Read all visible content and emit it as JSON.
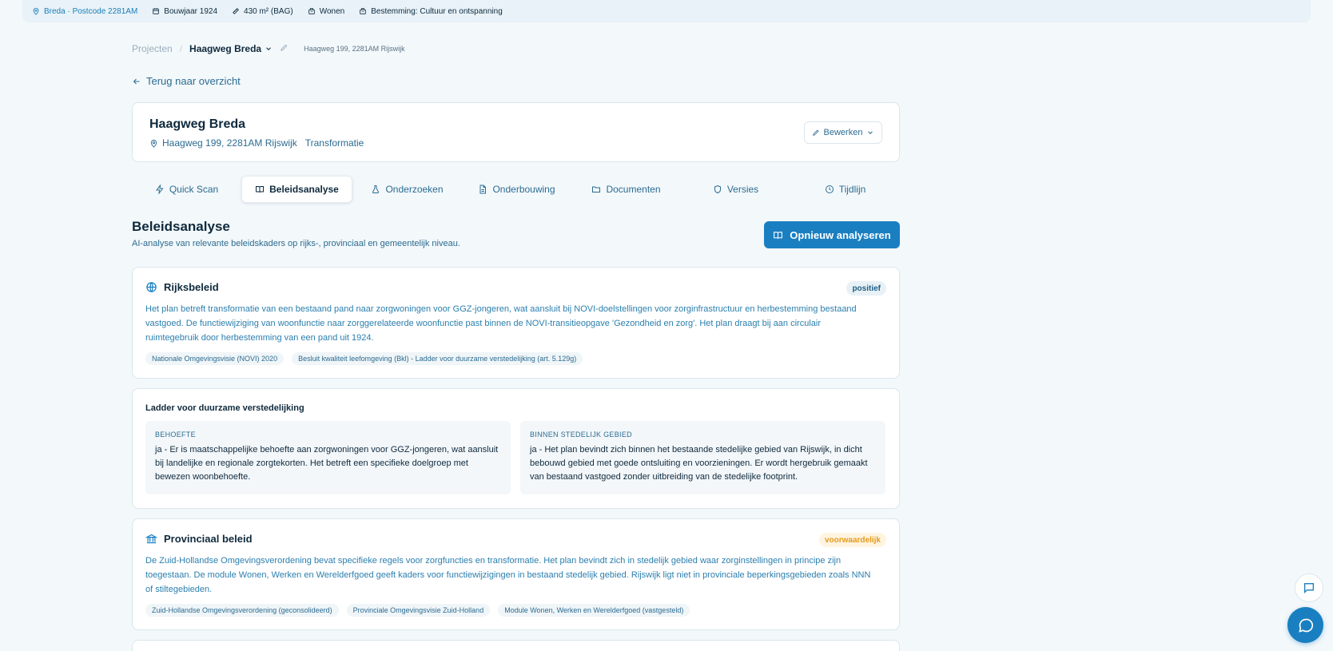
{
  "topbar": {
    "location": "Breda · Postcode 2281AM",
    "year": "Bouwjaar 1924",
    "area": "430 m² (BAG)",
    "function": "Wonen",
    "destination": "Bestemming: Cultuur en ontspanning"
  },
  "breadcrumb": {
    "root": "Projecten",
    "separator": "/",
    "project": "Haagweg Breda",
    "address": "Haagweg 199, 2281AM Rijswijk"
  },
  "back_link": "Terug naar overzicht",
  "header": {
    "title": "Haagweg Breda",
    "address": "Haagweg 199, 2281AM Rijswijk",
    "type": "Transformatie",
    "edit_label": "Bewerken"
  },
  "tabs": [
    {
      "label": "Quick Scan",
      "icon": "lightning-icon"
    },
    {
      "label": "Beleidsanalyse",
      "icon": "book-icon",
      "active": true
    },
    {
      "label": "Onderzoeken",
      "icon": "flask-icon"
    },
    {
      "label": "Onderbouwing",
      "icon": "document-icon"
    },
    {
      "label": "Documenten",
      "icon": "folder-icon"
    },
    {
      "label": "Versies",
      "icon": "shield-icon"
    },
    {
      "label": "Tijdlijn",
      "icon": "clock-icon"
    }
  ],
  "section": {
    "title": "Beleidsanalyse",
    "subtitle": "AI-analyse van relevante beleidskaders op rijks-, provinciaal en gemeentelijk niveau.",
    "reanalyze_label": "Opnieuw analyseren"
  },
  "rijksbeleid": {
    "title": "Rijksbeleid",
    "badge": "positief",
    "text": "Het plan betreft transformatie van een bestaand pand naar zorgwoningen voor GGZ-jongeren, wat aansluit bij NOVI-doelstellingen voor zorginfrastructuur en herbestemming bestaand vastgoed. De functiewijziging van woonfunctie naar zorggerelateerde woonfunctie past binnen de NOVI-transitieopgave 'Gezondheid en zorg'. Het plan draagt bij aan circulair ruimtegebruik door herbestemming van een pand uit 1924.",
    "tags": [
      "Nationale Omgevingsvisie (NOVI) 2020",
      "Besluit kwaliteit leefomgeving (Bkl) - Ladder voor duurzame verstedelijking (art. 5.129g)"
    ]
  },
  "ladder": {
    "title": "Ladder voor duurzame verstedelijking",
    "need_label": "BEHOEFTE",
    "need_text": "ja - Er is maatschappelijke behoefte aan zorgwoningen voor GGZ-jongeren, wat aansluit bij landelijke en regionale zorgtekorten. Het betreft een specifieke doelgroep met bewezen woonbehoefte.",
    "urban_label": "BINNEN STEDELIJK GEBIED",
    "urban_text": "ja - Het plan bevindt zich binnen het bestaande stedelijke gebied van Rijswijk, in dicht bebouwd gebied met goede ontsluiting en voorzieningen. Er wordt hergebruik gemaakt van bestaand vastgoed zonder uitbreiding van de stedelijke footprint."
  },
  "provinciaal": {
    "title": "Provinciaal beleid",
    "badge": "voorwaardelijk",
    "text": "De Zuid-Hollandse Omgevingsverordening bevat specifieke regels voor zorgfuncties en transformatie. Het plan bevindt zich in stedelijk gebied waar zorginstellingen in principe zijn toegestaan. De module Wonen, Werken en Werelderfgoed geeft kaders voor functiewijzigingen in bestaand stedelijk gebied. Rijswijk ligt niet in provinciale beperkingsgebieden zoals NNN of stiltegebieden.",
    "tags": [
      "Zuid-Hollandse Omgevingsverordening (geconsolideerd)",
      "Provinciale Omgevingsvisie Zuid-Holland",
      "Module Wonen, Werken en Werelderfgoed (vastgesteld)"
    ]
  },
  "colors": {
    "accent": "#1a7fc1",
    "positive_badge_bg": "#e8f1f6",
    "conditional_badge_text": "#e59a1c"
  }
}
